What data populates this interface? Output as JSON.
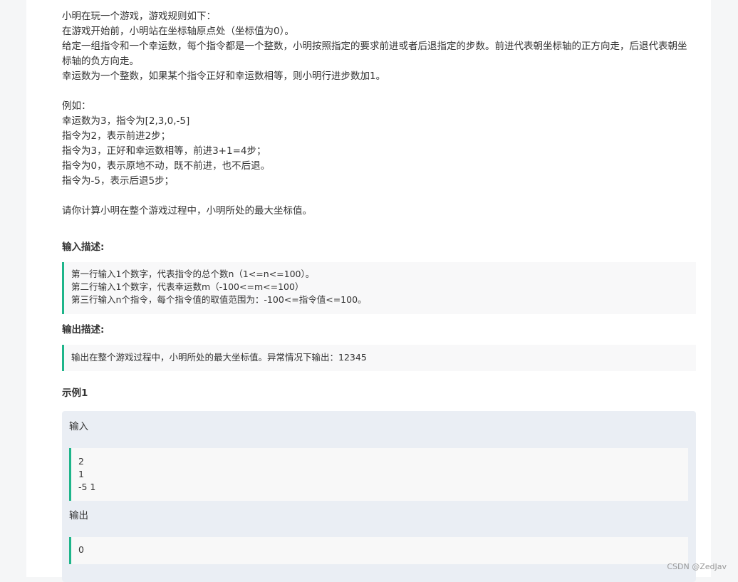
{
  "intro": {
    "lines": [
      "小明在玩一个游戏，游戏规则如下：",
      "在游戏开始前，小明站在坐标轴原点处（坐标值为0）。",
      "给定一组指令和一个幸运数，每个指令都是一个整数，小明按照指定的要求前进或者后退指定的步数。前进代表朝坐标轴的正方向走，后退代表朝坐标轴的负方向走。",
      "幸运数为一个整数，如果某个指令正好和幸运数相等，则小明行进步数加1。"
    ]
  },
  "example_text": {
    "lines": [
      "例如：",
      "幸运数为3，指令为[2,3,0,-5]",
      "指令为2，表示前进2步；",
      "指令为3，正好和幸运数相等，前进3+1=4步；",
      "指令为0，表示原地不动，既不前进，也不后退。",
      "指令为-5，表示后退5步；"
    ]
  },
  "question": "请你计算小明在整个游戏过程中，小明所处的最大坐标值。",
  "input_desc": {
    "title": "输入描述:",
    "lines": [
      "第一行输入1个数字，代表指令的总个数n（1<=n<=100）。",
      "第二行输入1个数字，代表幸运数m（-100<=m<=100）",
      "第三行输入n个指令，每个指令值的取值范围为：-100<=指令值<=100。"
    ]
  },
  "output_desc": {
    "title": "输出描述:",
    "text": "输出在整个游戏过程中，小明所处的最大坐标值。异常情况下输出：12345"
  },
  "example1": {
    "title": "示例1",
    "input_label": "输入",
    "input_lines": [
      "2",
      "1",
      "-5 1"
    ],
    "output_label": "输出",
    "output_value": "0"
  },
  "watermark": "CSDN @ZedJav"
}
